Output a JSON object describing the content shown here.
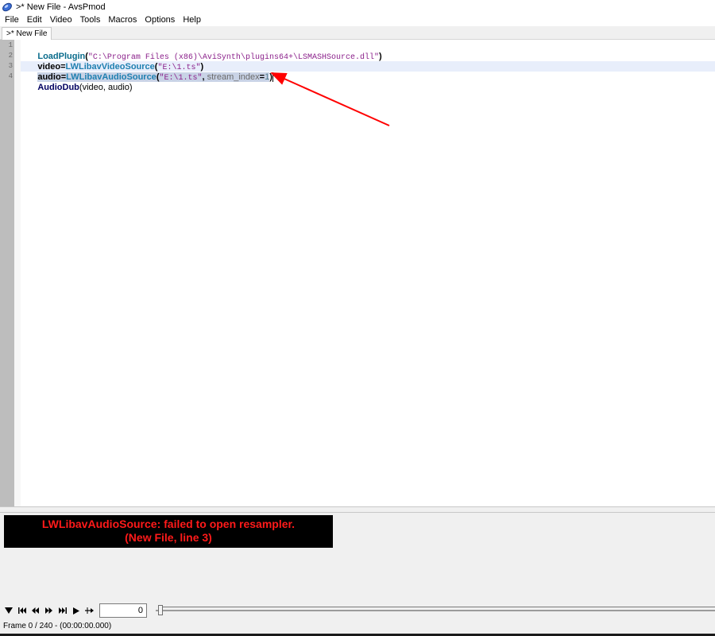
{
  "window": {
    "title": ">* New File - AvsPmod"
  },
  "menu": [
    "File",
    "Edit",
    "Video",
    "Tools",
    "Macros",
    "Options",
    "Help"
  ],
  "tab": {
    "label": ">* New File"
  },
  "editor": {
    "line_numbers": [
      "1",
      "2",
      "3",
      "4"
    ],
    "line1": {
      "func": "LoadPlugin",
      "open": "(",
      "string": "\"C:\\Program Files (x86)\\AviSynth\\plugins64+\\LSMASHSource.dll\"",
      "close": ")"
    },
    "line2": {
      "var": "video",
      "eq": "=",
      "func": "LWLibavVideoSource",
      "open": "(",
      "string": "\"E:\\1.ts\"",
      "close": ")"
    },
    "line3": {
      "var": "audio",
      "eq": "=",
      "func": "LWLibavAudioSource",
      "open": "(",
      "string": "\"E:\\1.ts\"",
      "comma": ",",
      "param": " stream_index",
      "eq2": "=",
      "value": "1",
      "close": ")"
    },
    "line4": {
      "func": "AudioDub",
      "open": "(",
      "args": "video, audio",
      "close": ")"
    }
  },
  "annotation": {
    "color": "#ff0000"
  },
  "error": {
    "line1": "LWLibavAudioSource: failed to open resampler.",
    "line2": "(New File, line 3)"
  },
  "playback": {
    "buttons": [
      "toggle-preview-icon",
      "first-frame-icon",
      "prev-frame-icon",
      "next-frame-icon",
      "last-frame-icon",
      "play-icon",
      "bookmark-icon"
    ],
    "frame_value": "0",
    "slider_position": 0
  },
  "status": {
    "text": "Frame 0 / 240  -  (00:00:00.000)"
  },
  "colors": {
    "error_text": "#ff1a1a",
    "error_bg": "#000000",
    "gutter": "#bdbdbd"
  }
}
